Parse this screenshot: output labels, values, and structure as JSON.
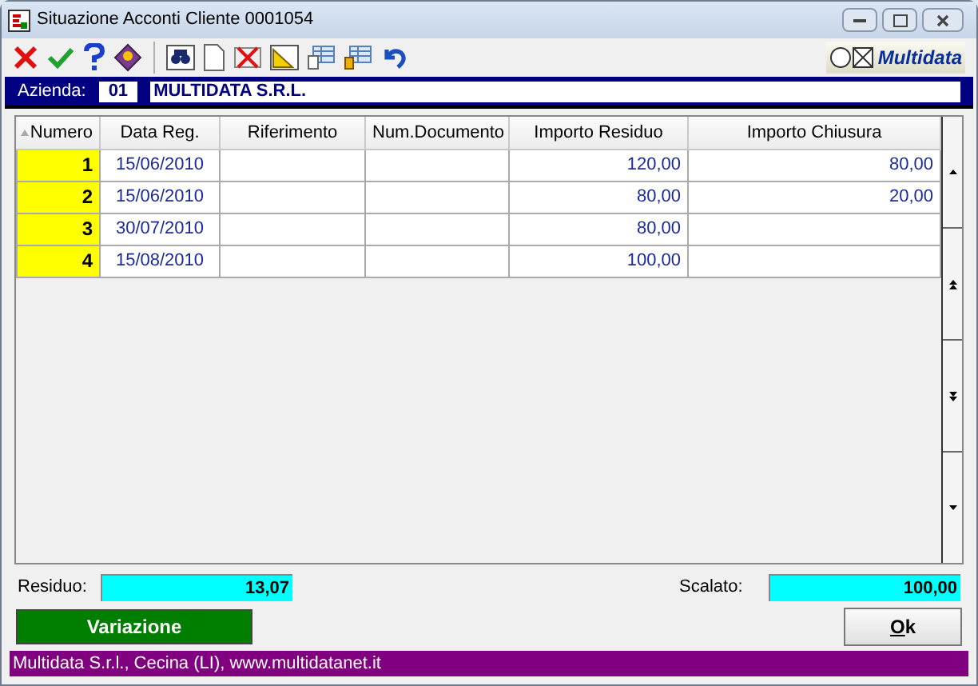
{
  "window": {
    "title": "Situazione Acconti Cliente 0001054"
  },
  "logo": {
    "text": "Multidata"
  },
  "azienda": {
    "label": "Azienda:",
    "code": "01",
    "name": "MULTIDATA S.R.L."
  },
  "table": {
    "columns": [
      "Numero",
      "Data Reg.",
      "Riferimento",
      "Num.Documento",
      "Importo Residuo",
      "Importo Chiusura"
    ],
    "rows": [
      {
        "numero": "1",
        "data": "15/06/2010",
        "riferimento": "",
        "num_documento": "",
        "importo_residuo": "120,00",
        "importo_chiusura": "80,00"
      },
      {
        "numero": "2",
        "data": "15/06/2010",
        "riferimento": "",
        "num_documento": "",
        "importo_residuo": "80,00",
        "importo_chiusura": "20,00"
      },
      {
        "numero": "3",
        "data": "30/07/2010",
        "riferimento": "",
        "num_documento": "",
        "importo_residuo": "80,00",
        "importo_chiusura": ""
      },
      {
        "numero": "4",
        "data": "15/08/2010",
        "riferimento": "",
        "num_documento": "",
        "importo_residuo": "100,00",
        "importo_chiusura": ""
      }
    ]
  },
  "totals": {
    "residuo_label": "Residuo:",
    "residuo": "13,07",
    "scalato_label": "Scalato:",
    "scalato": "100,00"
  },
  "buttons": {
    "variazione": "Variazione",
    "ok": "Ok"
  },
  "status_bar": "Multidata S.r.l., Cecina (LI), www.multidatanet.it"
}
